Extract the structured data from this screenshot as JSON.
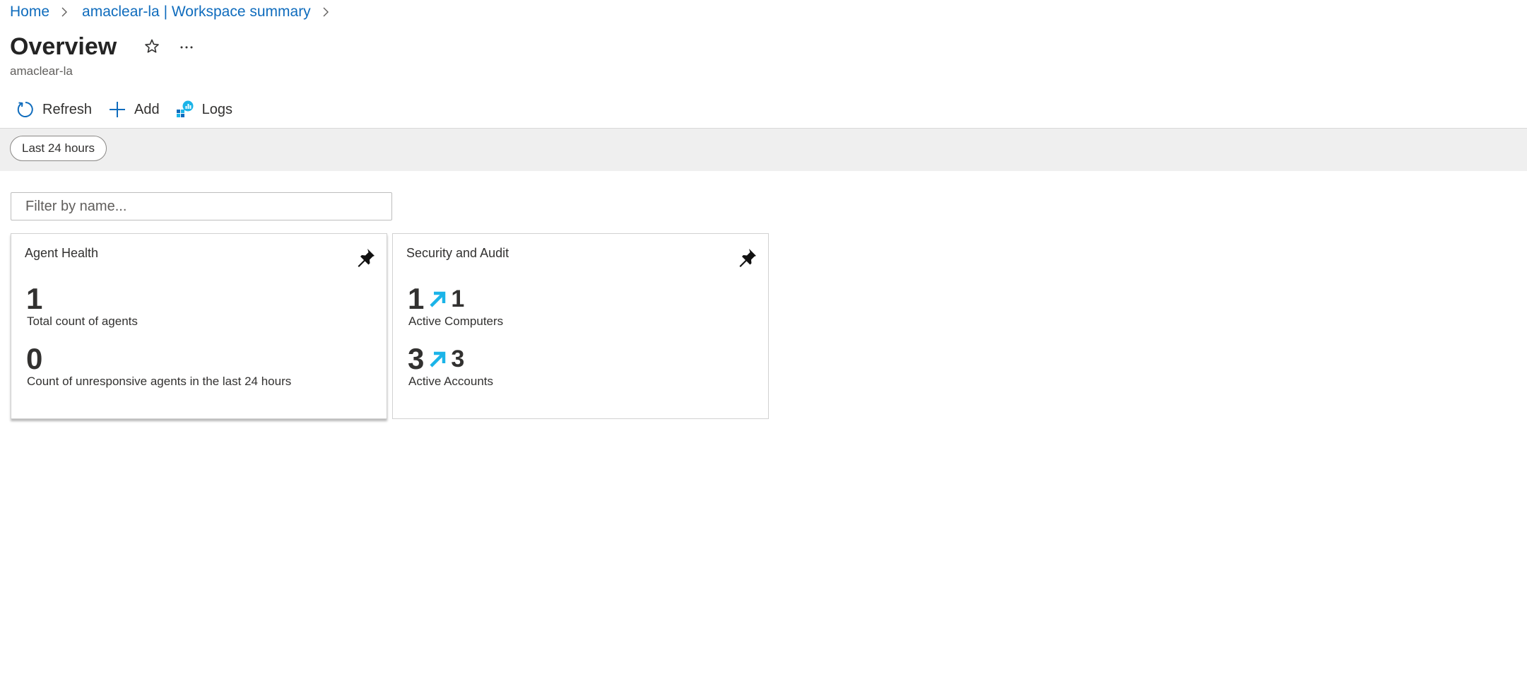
{
  "breadcrumb": {
    "items": [
      "Home",
      "amaclear-la | Workspace summary"
    ]
  },
  "header": {
    "title": "Overview",
    "subtitle": "amaclear-la"
  },
  "toolbar": {
    "refresh_label": "Refresh",
    "add_label": "Add",
    "logs_label": "Logs"
  },
  "filters": {
    "time_range": "Last 24 hours"
  },
  "search": {
    "placeholder": "Filter by name...",
    "value": ""
  },
  "tiles": [
    {
      "title": "Agent Health",
      "metrics": [
        {
          "value": "1",
          "label": "Total count of agents"
        },
        {
          "value": "0",
          "label": "Count of unresponsive agents in the last 24 hours"
        }
      ]
    },
    {
      "title": "Security and Audit",
      "metrics": [
        {
          "value": "1",
          "trend": "1",
          "label": "Active Computers"
        },
        {
          "value": "3",
          "trend": "3",
          "label": "Active Accounts"
        }
      ]
    }
  ],
  "colors": {
    "link": "#0f6cbd",
    "trend_arrow": "#1bb4e8",
    "band": "#efefef"
  }
}
